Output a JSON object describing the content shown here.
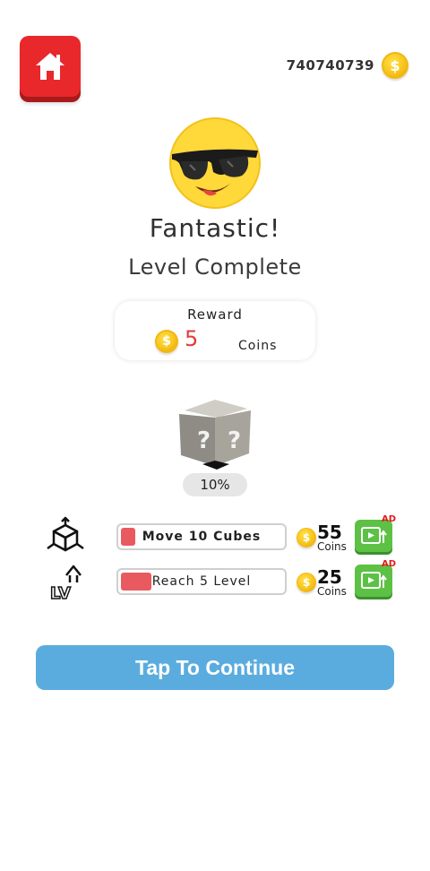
{
  "header": {
    "home_icon": "home-icon",
    "coin_balance": "740740739",
    "coin_icon_symbol": "$"
  },
  "result": {
    "emoji_icon": "cool-sunglasses-emoji-icon",
    "title": "Fantastic!",
    "subtitle": "Level Complete"
  },
  "reward": {
    "label": "Reward",
    "value": "5",
    "unit": "Coins",
    "coin_symbol": "$"
  },
  "mystery_box": {
    "icon": "mystery-cube-icon",
    "progress_text": "10%",
    "progress": 0.1
  },
  "tasks": [
    {
      "icon": "cube-move-icon",
      "label": "Move 10 Cubes",
      "progress": 0.1,
      "reward_value": "55",
      "reward_unit": "Coins",
      "coin_symbol": "$",
      "ad_tag": "AD",
      "ad_icon": "video-ad-icon"
    },
    {
      "icon": "level-up-icon",
      "icon_text": "LV",
      "label": "Reach 5 Level",
      "progress": 0.2,
      "reward_value": "25",
      "reward_unit": "Coins",
      "coin_symbol": "$",
      "ad_tag": "AD",
      "ad_icon": "video-ad-icon"
    }
  ],
  "actions": {
    "continue_label": "Tap To Continue"
  },
  "colors": {
    "home_red": "#e8282b",
    "reward_red": "#e23b3b",
    "task_fill": "#e85a60",
    "ad_green": "#5cc145",
    "continue_blue": "#5aacdf",
    "coin_gold": "#f6c21a"
  }
}
